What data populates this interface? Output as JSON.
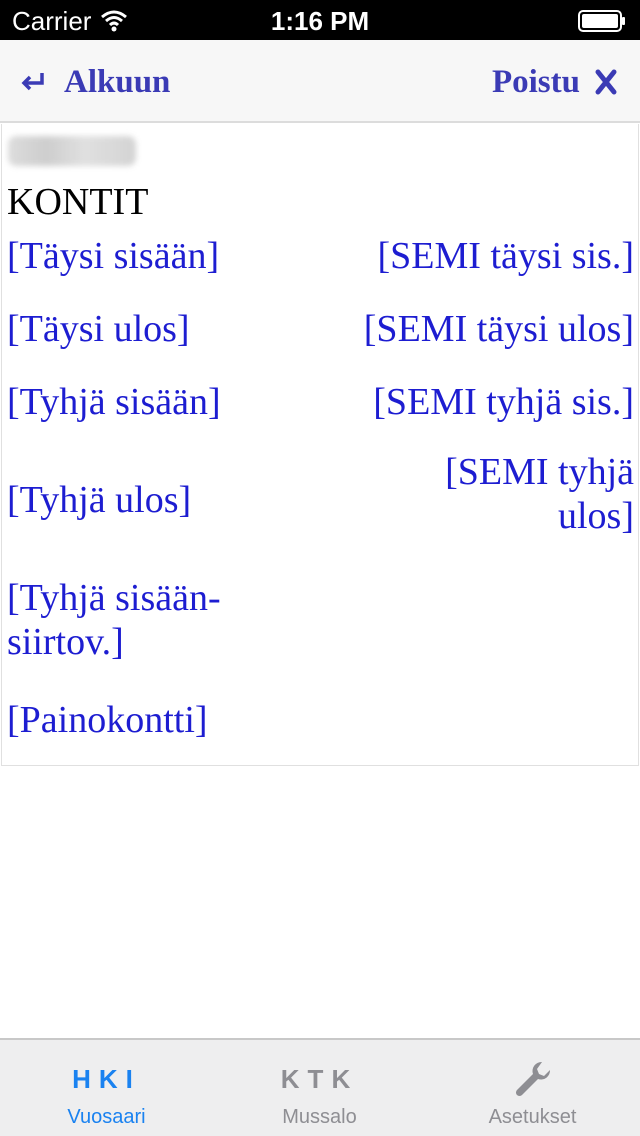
{
  "status_bar": {
    "carrier": "Carrier",
    "time": "1:16 PM"
  },
  "nav": {
    "back_label": "Alkuun",
    "exit_label": "Poistu",
    "accent_color": "#3b3bb5"
  },
  "content": {
    "section_title": "KONTIT",
    "link_color": "#1d1dd1",
    "left_links": [
      "[Täysi sisään]",
      "[Täysi ulos]",
      "[Tyhjä sisään]",
      "[Tyhjä ulos]",
      "[Tyhjä sisään-siirtov.]",
      "[Painokontti]"
    ],
    "right_links": [
      "[SEMI täysi sis.]",
      "[SEMI täysi ulos]",
      "[SEMI tyhjä sis.]",
      "[SEMI tyhjä ulos]"
    ]
  },
  "tabbar": {
    "tabs": [
      {
        "icon_text": "HKI",
        "label": "Vuosaari",
        "active": true
      },
      {
        "icon_text": "KTK",
        "label": "Mussalo",
        "active": false
      },
      {
        "icon": "wrench-icon",
        "label": "Asetukset",
        "active": false
      }
    ],
    "active_color": "#1a82f0",
    "inactive_color": "#8e8e93"
  }
}
